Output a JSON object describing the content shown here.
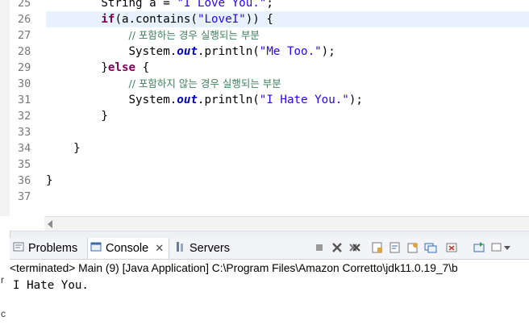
{
  "editor": {
    "lines": [
      {
        "no": "25",
        "indent": "        ",
        "tokens": [
          {
            "t": "String a = ",
            "c": ""
          },
          {
            "t": "\"I Love You.\"",
            "c": "str"
          },
          {
            "t": ";",
            "c": ""
          }
        ]
      },
      {
        "no": "26",
        "indent": "        ",
        "hl": true,
        "tokens": [
          {
            "t": "if",
            "c": "kw"
          },
          {
            "t": "(a.contains(",
            "c": ""
          },
          {
            "t": "\"LoveI\"",
            "c": "str"
          },
          {
            "t": ")) {",
            "c": ""
          }
        ]
      },
      {
        "no": "27",
        "indent": "            ",
        "tokens": [
          {
            "t": "// 포함하는 경우 실행되는 부분",
            "c": "cmt"
          }
        ]
      },
      {
        "no": "28",
        "indent": "            ",
        "tokens": [
          {
            "t": "System.",
            "c": ""
          },
          {
            "t": "out",
            "c": "fld"
          },
          {
            "t": ".println(",
            "c": ""
          },
          {
            "t": "\"Me Too.\"",
            "c": "str"
          },
          {
            "t": ");",
            "c": ""
          }
        ]
      },
      {
        "no": "29",
        "indent": "        ",
        "tokens": [
          {
            "t": "}",
            "c": ""
          },
          {
            "t": "else",
            "c": "kw"
          },
          {
            "t": " {",
            "c": ""
          }
        ]
      },
      {
        "no": "30",
        "indent": "            ",
        "tokens": [
          {
            "t": "// 포함하지 않는 경우 실행되는 부분",
            "c": "cmt"
          }
        ]
      },
      {
        "no": "31",
        "indent": "            ",
        "tokens": [
          {
            "t": "System.",
            "c": ""
          },
          {
            "t": "out",
            "c": "fld"
          },
          {
            "t": ".println(",
            "c": ""
          },
          {
            "t": "\"I Hate You.\"",
            "c": "str"
          },
          {
            "t": ");",
            "c": ""
          }
        ]
      },
      {
        "no": "32",
        "indent": "        ",
        "tokens": [
          {
            "t": "}",
            "c": ""
          }
        ]
      },
      {
        "no": "33",
        "indent": "",
        "tokens": []
      },
      {
        "no": "34",
        "indent": "    ",
        "tokens": [
          {
            "t": "}",
            "c": ""
          }
        ]
      },
      {
        "no": "35",
        "indent": "",
        "tokens": []
      },
      {
        "no": "36",
        "indent": "",
        "tokens": [
          {
            "t": "}",
            "c": ""
          }
        ]
      },
      {
        "no": "37",
        "indent": "",
        "tokens": []
      }
    ]
  },
  "tabs": {
    "problems": "Problems",
    "console": "Console",
    "servers": "Servers"
  },
  "status": "<terminated> Main (9) [Java Application] C:\\Program Files\\Amazon Corretto\\jdk11.0.19_7\\b",
  "console_output": "I Hate You.",
  "left_strip_text": "c",
  "colors": {
    "keyword": "#7f0055",
    "string": "#2a00ff",
    "field": "#0000c0",
    "comment": "#3f7f5f",
    "current_line": "#e8f2fe"
  },
  "icons": [
    "problems-icon",
    "console-icon",
    "servers-icon",
    "terminate-icon",
    "remove-launch-icon",
    "remove-all-icon",
    "scroll-lock-icon",
    "word-wrap-icon",
    "pin-console-icon",
    "display-selected-console-icon",
    "open-console-icon",
    "new-console-icon",
    "menu-icon"
  ]
}
